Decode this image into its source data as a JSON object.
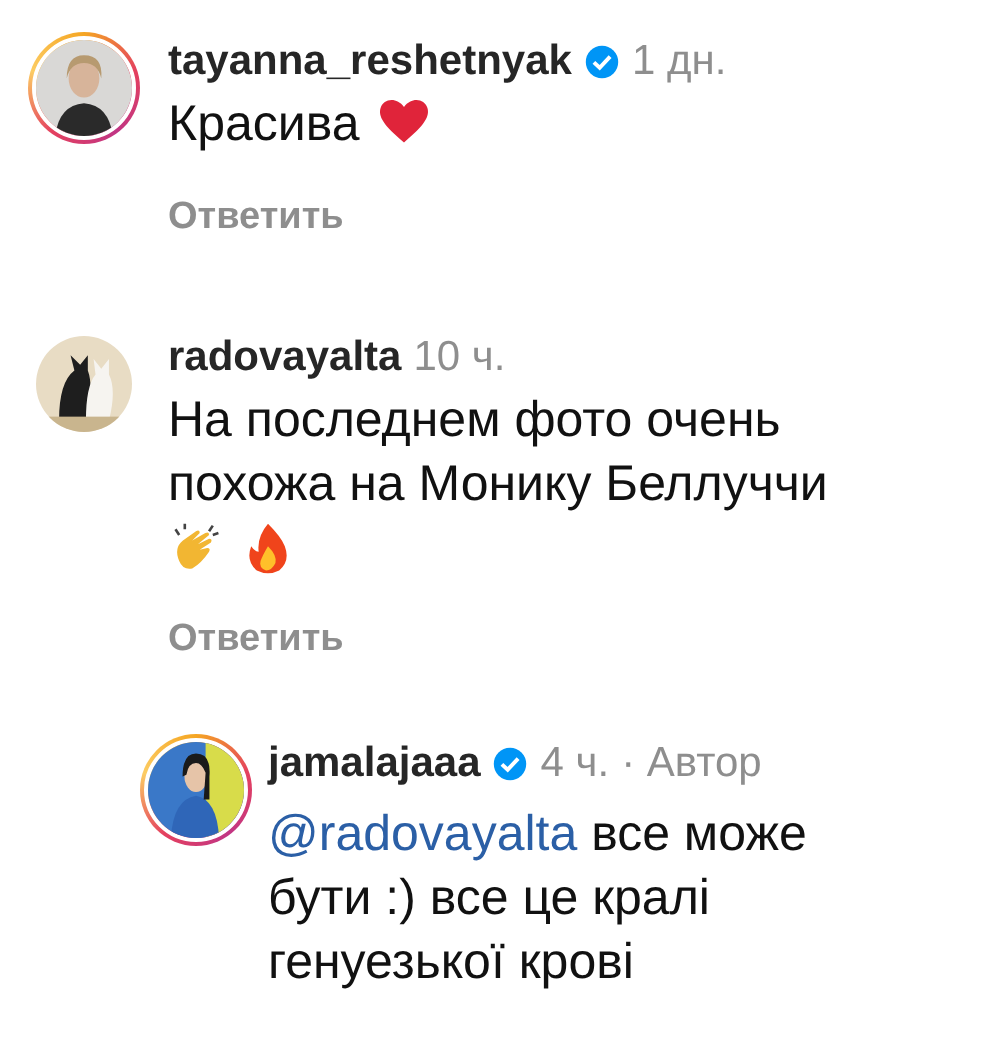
{
  "comments": [
    {
      "username": "tayanna_reshetnyak",
      "verified": true,
      "time": "1 дн.",
      "story_ring": true,
      "text": "Красива",
      "emojis": [
        {
          "kind": "heart"
        }
      ],
      "emojis_on_new_line": false,
      "reply": "Ответить"
    },
    {
      "username": "radovayalta",
      "verified": false,
      "time": "10 ч.",
      "story_ring": false,
      "text": "На последнем фото очень похожа на Монику Беллуччи",
      "emojis": [
        {
          "kind": "clap"
        },
        {
          "kind": "fire"
        }
      ],
      "emojis_on_new_line": true,
      "reply": "Ответить",
      "children": [
        {
          "username": "jamalajaaa",
          "verified": true,
          "time": "4 ч.",
          "author_label": "· Автор",
          "story_ring": true,
          "mention": "@radovayalta",
          "text": "все може бути :) все це кралі генуезької крові"
        }
      ]
    }
  ]
}
